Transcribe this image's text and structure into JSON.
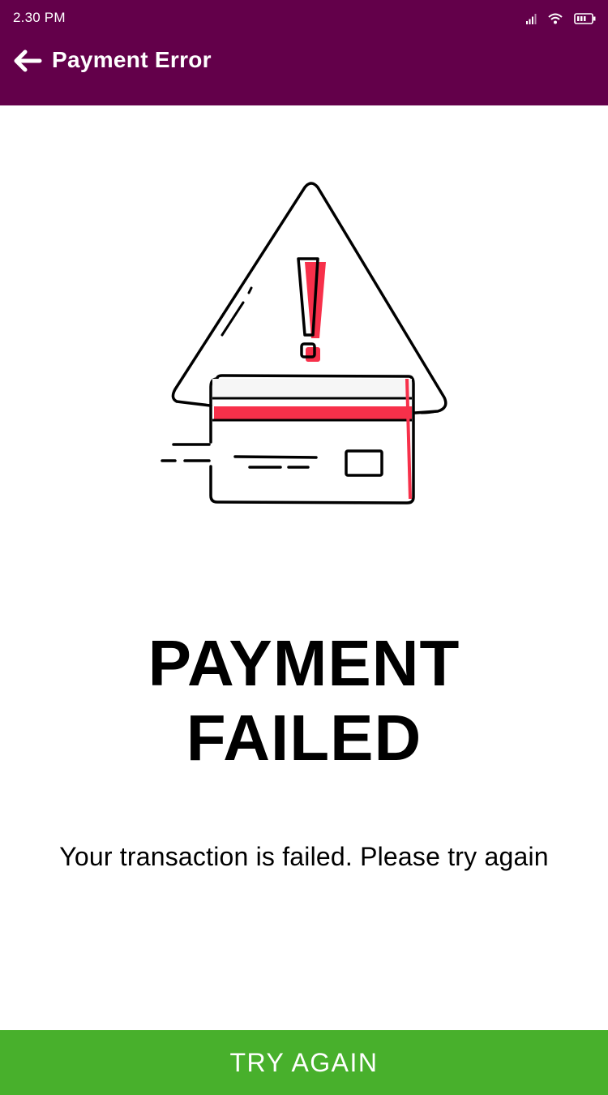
{
  "status_bar": {
    "time": "2.30 PM",
    "icons": [
      "signal-icon",
      "wifi-icon",
      "battery-icon"
    ]
  },
  "app_bar": {
    "title": "Payment Error",
    "back_icon": "arrow-left-icon",
    "background_color": "#63004a"
  },
  "illustration": {
    "name": "payment-failed-card-warning",
    "accent_color": "#f7304a"
  },
  "main": {
    "headline_line1": "PAYMENT",
    "headline_line2": "FAILED",
    "message": "Your transaction is failed. Please try again"
  },
  "action": {
    "label": "TRY AGAIN",
    "color": "#48b02c"
  }
}
